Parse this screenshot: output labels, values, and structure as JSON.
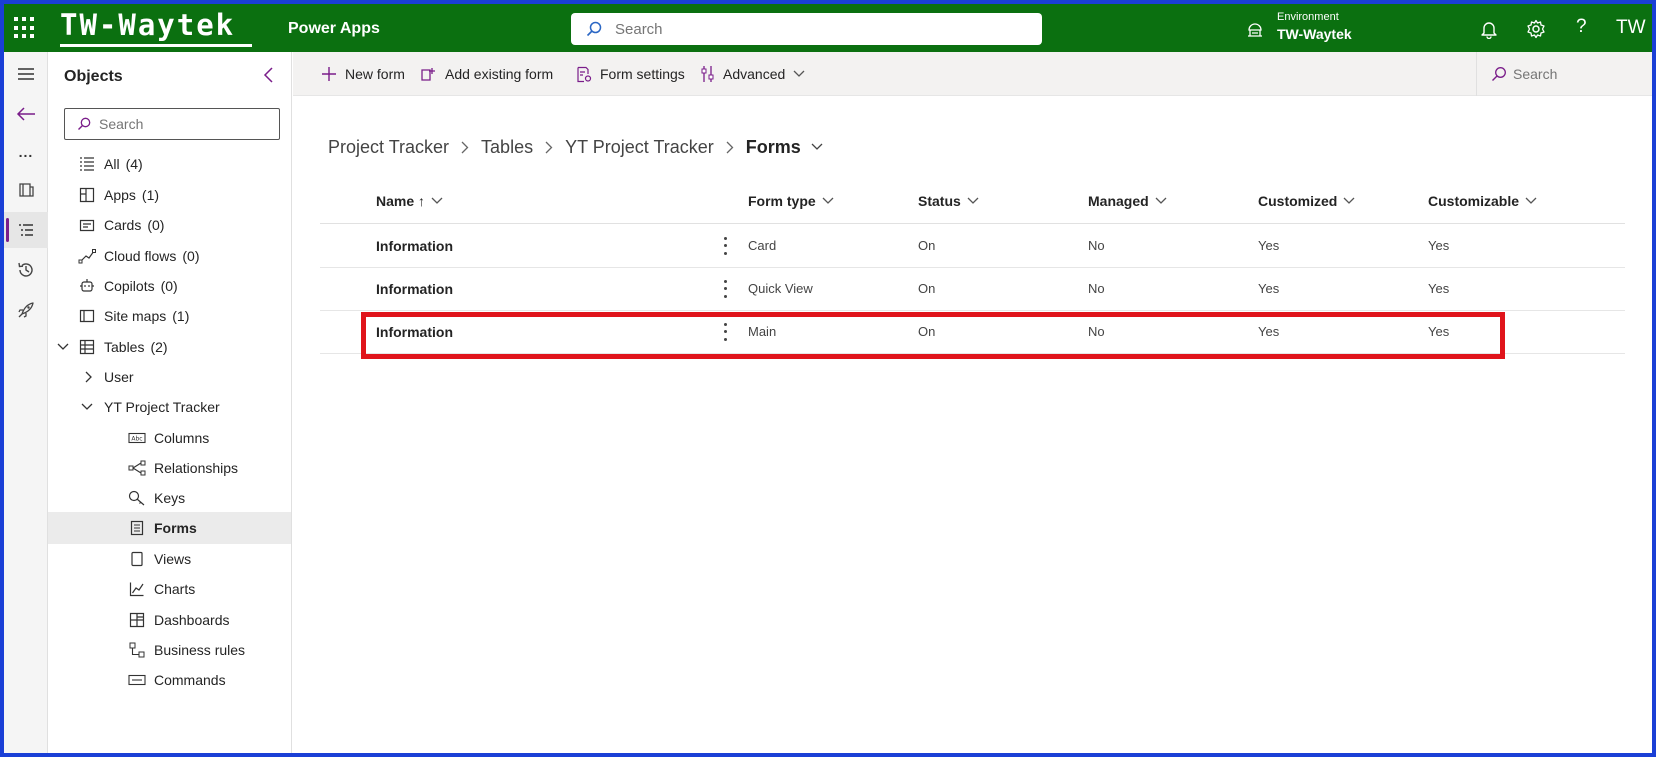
{
  "topbar": {
    "logo": "TW-Waytek",
    "app_name": "Power Apps",
    "search_placeholder": "Search",
    "environment_label": "Environment",
    "environment_name": "TW-Waytek",
    "help": "?",
    "avatar_initials": "TW"
  },
  "rail": {
    "more": "..."
  },
  "objects": {
    "title": "Objects",
    "search_placeholder": "Search",
    "items": [
      {
        "label": "All",
        "count": "(4)",
        "icon": "list-icon"
      },
      {
        "label": "Apps",
        "count": "(1)",
        "icon": "apps-icon"
      },
      {
        "label": "Cards",
        "count": "(0)",
        "icon": "card-icon"
      },
      {
        "label": "Cloud flows",
        "count": "(0)",
        "icon": "flow-icon"
      },
      {
        "label": "Copilots",
        "count": "(0)",
        "icon": "copilot-icon"
      },
      {
        "label": "Site maps",
        "count": "(1)",
        "icon": "sitemap-icon"
      },
      {
        "label": "Tables",
        "count": "(2)",
        "icon": "table-icon"
      },
      {
        "label": "User",
        "count": "",
        "icon": "chevron-right-icon"
      },
      {
        "label": "YT Project Tracker",
        "count": "",
        "icon": "chevron-down-icon"
      },
      {
        "label": "Columns",
        "count": "",
        "icon": "columns-icon"
      },
      {
        "label": "Relationships",
        "count": "",
        "icon": "relationships-icon"
      },
      {
        "label": "Keys",
        "count": "",
        "icon": "key-icon"
      },
      {
        "label": "Forms",
        "count": "",
        "icon": "form-icon"
      },
      {
        "label": "Views",
        "count": "",
        "icon": "view-icon"
      },
      {
        "label": "Charts",
        "count": "",
        "icon": "chart-icon"
      },
      {
        "label": "Dashboards",
        "count": "",
        "icon": "dashboard-icon"
      },
      {
        "label": "Business rules",
        "count": "",
        "icon": "business-rule-icon"
      },
      {
        "label": "Commands",
        "count": "",
        "icon": "command-icon"
      }
    ],
    "selected": "Forms"
  },
  "cmdbar": {
    "new_form": "New form",
    "add_existing_form": "Add existing form",
    "form_settings": "Form settings",
    "advanced": "Advanced",
    "search_placeholder": "Search"
  },
  "breadcrumb": [
    "Project Tracker",
    "Tables",
    "YT Project Tracker",
    "Forms"
  ],
  "table": {
    "columns": [
      "Name ↑",
      "Form type",
      "Status",
      "Managed",
      "Customized",
      "Customizable"
    ],
    "rows": [
      {
        "name": "Information",
        "form_type": "Card",
        "status": "On",
        "managed": "No",
        "customized": "Yes",
        "customizable": "Yes"
      },
      {
        "name": "Information",
        "form_type": "Quick View",
        "status": "On",
        "managed": "No",
        "customized": "Yes",
        "customizable": "Yes"
      },
      {
        "name": "Information",
        "form_type": "Main",
        "status": "On",
        "managed": "No",
        "customized": "Yes",
        "customizable": "Yes"
      }
    ]
  },
  "colors": {
    "topbar": "#0b7010",
    "frame": "#1a3fd6",
    "highlight": "#e0141b",
    "accent": "#7a1d8a"
  }
}
